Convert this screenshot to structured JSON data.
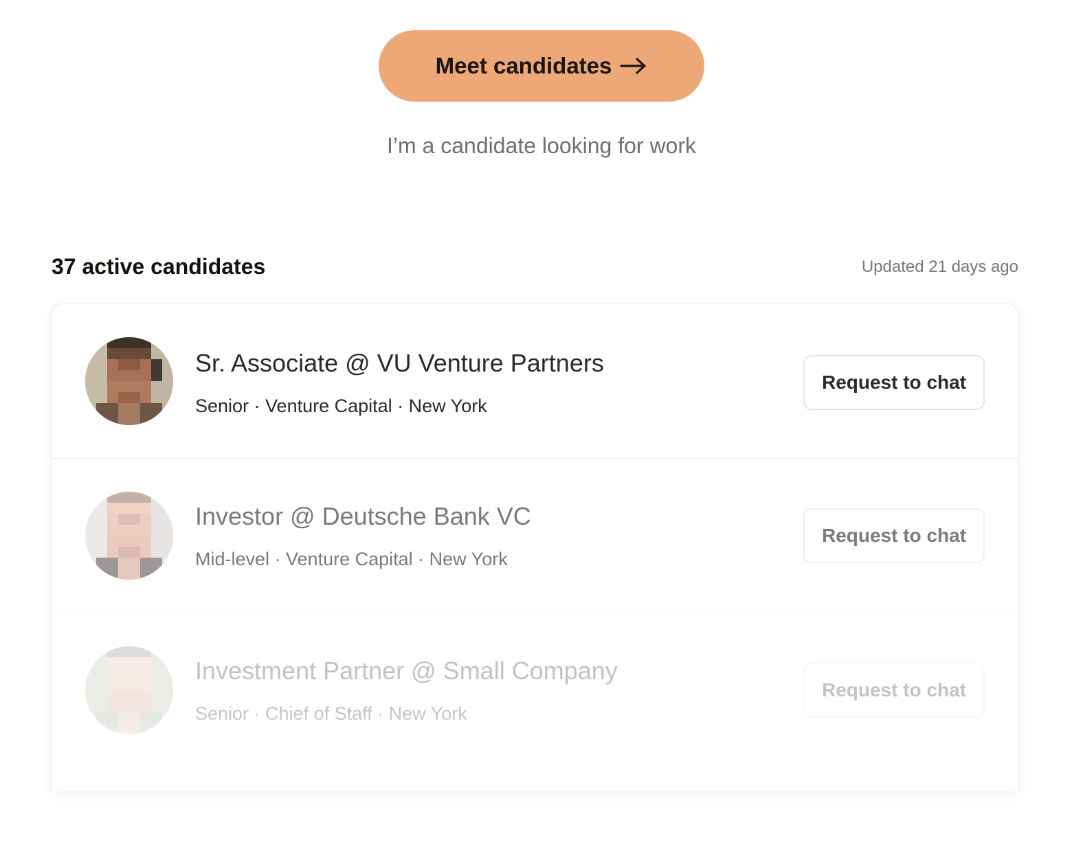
{
  "hero": {
    "cta_label": "Meet candidates",
    "secondary_link": "I’m a candidate looking for work"
  },
  "list": {
    "title": "37 active candidates",
    "updated": "Updated 21 days ago"
  },
  "candidates": [
    {
      "role": "Sr. Associate @ VU Venture Partners",
      "meta": "Senior · Venture Capital · New York",
      "button_label": "Request to chat"
    },
    {
      "role": "Investor @ Deutsche Bank VC",
      "meta": "Mid-level · Venture Capital · New York",
      "button_label": "Request to chat"
    },
    {
      "role": "Investment Partner @ Small Company",
      "meta": "Senior · Chief of Staff · New York",
      "button_label": "Request to chat"
    }
  ],
  "colors": {
    "accent": "#eea877",
    "text_primary": "#2d2924",
    "text_muted": "#6f6f6f"
  },
  "icons": {
    "cta_arrow": "arrow-right-icon",
    "avatar": "pixelated-avatar"
  }
}
